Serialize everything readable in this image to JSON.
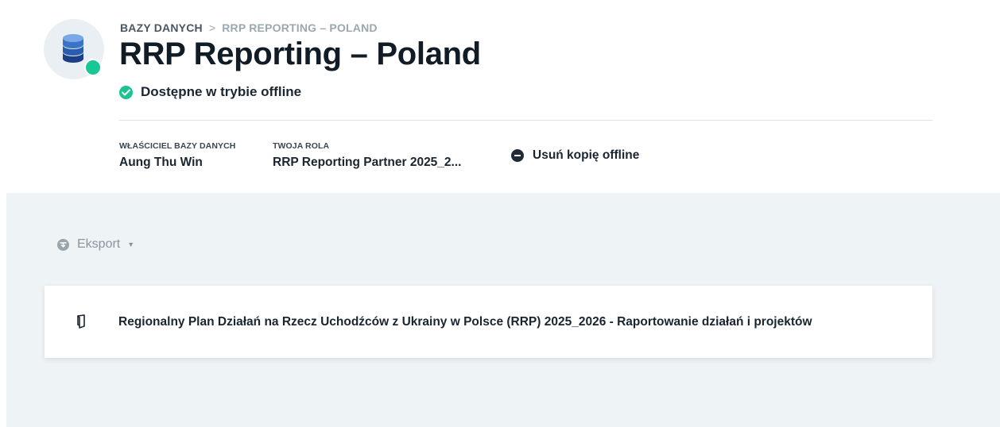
{
  "breadcrumb": {
    "root": "BAZY DANYCH",
    "separator": ">",
    "current": "RRP REPORTING – POLAND"
  },
  "page_title": "RRP Reporting – Poland",
  "status": {
    "text": "Dostępne w trybie offline",
    "icon": "check-circle-icon",
    "color": "#1cc391"
  },
  "meta": {
    "owner_label": "WŁAŚCICIEL BAZY DANYCH",
    "owner_value": "Aung Thu Win",
    "role_label": "TWOJA ROLA",
    "role_value": "RRP Reporting Partner 2025_2..."
  },
  "actions": {
    "remove_offline_label": "Usuń kopię offline",
    "remove_offline_icon": "minus-circle-icon"
  },
  "toolbar": {
    "export_label": "Eksport",
    "export_icon": "export-icon",
    "caret_icon": "caret-down-icon"
  },
  "forms": [
    {
      "icon": "form-icon",
      "title": "Regionalny Plan Działań na Rzecz Uchodźców z Ukrainy w Polsce (RRP) 2025_2026 - Raportowanie działań i projektów"
    }
  ],
  "colors": {
    "accent_green": "#19c794",
    "background_panel": "#eef3f5",
    "db_icon_blue": "#1f4fa3"
  }
}
